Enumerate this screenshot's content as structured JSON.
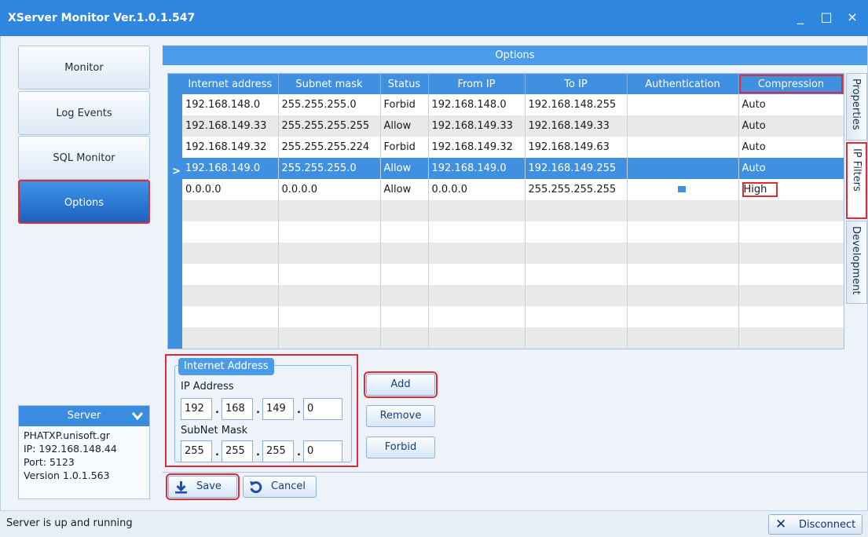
{
  "window": {
    "title": "XServer Monitor Ver.1.0.1.547",
    "minimize": "_",
    "maximize": "□",
    "close": "×"
  },
  "nav": {
    "items": [
      {
        "label": "Monitor",
        "active": false
      },
      {
        "label": "Log Events",
        "active": false
      },
      {
        "label": "SQL Monitor",
        "active": false
      },
      {
        "label": "Options",
        "active": true
      }
    ]
  },
  "server": {
    "header": "Server",
    "host": "PHATXP.unisoft.gr",
    "ip": "IP: 192.168.148.44",
    "port": "Port: 5123",
    "version": "Version 1.0.1.563"
  },
  "options": {
    "header": "Options",
    "columns": [
      "Internet address",
      "Subnet mask",
      "Status",
      "From IP",
      "To IP",
      "Authentication",
      "Compression"
    ],
    "rows": [
      [
        "192.168.148.0",
        "255.255.255.0",
        "Forbid",
        "192.168.148.0",
        "192.168.148.255",
        "",
        "Auto"
      ],
      [
        "192.168.149.33",
        "255.255.255.255",
        "Allow",
        "192.168.149.33",
        "192.168.149.33",
        "",
        "Auto"
      ],
      [
        "192.168.149.32",
        "255.255.255.224",
        "Forbid",
        "192.168.149.32",
        "192.168.149.63",
        "",
        "Auto"
      ],
      [
        "192.168.149.0",
        "255.255.255.0",
        "Allow",
        "192.168.149.0",
        "192.168.149.255",
        "",
        "Auto"
      ],
      [
        "0.0.0.0",
        "0.0.0.0",
        "Allow",
        "0.0.0.0",
        "255.255.255.255",
        "",
        "High"
      ]
    ],
    "selected_row": 3,
    "current_row_marker": ">"
  },
  "side_tabs": [
    {
      "label": "Properties",
      "active": false
    },
    {
      "label": "IP Filters",
      "active": true
    },
    {
      "label": "Development",
      "active": false
    }
  ],
  "internet_address": {
    "legend": "Internet Address",
    "ip_label": "IP Address",
    "ip": [
      "192",
      "168",
      "149",
      "0"
    ],
    "mask_label": "SubNet Mask",
    "mask": [
      "255",
      "255",
      "255",
      "0"
    ]
  },
  "buttons": {
    "add": "Add",
    "remove": "Remove",
    "forbid": "Forbid",
    "save": "Save",
    "cancel": "Cancel"
  },
  "status": {
    "text": "Server is up and running",
    "disconnect": "Disconnect"
  }
}
